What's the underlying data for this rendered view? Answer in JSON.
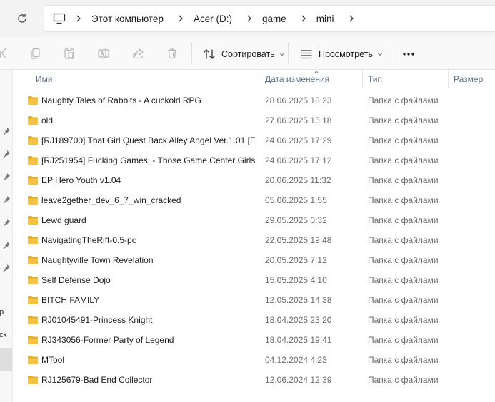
{
  "address": {
    "breadcrumbs": [
      "Этот компьютер",
      "Acer (D:)",
      "game",
      "mini"
    ]
  },
  "toolbar": {
    "sort_label": "Сортировать",
    "view_label": "Просмотреть",
    "more_label": "···"
  },
  "nav": {
    "text_1": "р",
    "text_2": "ск"
  },
  "columns": {
    "name": "Имя",
    "date": "Дата изменения",
    "type": "Тип",
    "size": "Размер"
  },
  "files": [
    {
      "name": "Naughty Tales of Rabbits - A cuckold RPG",
      "date": "28.06.2025 18:23",
      "type": "Папка с файлами"
    },
    {
      "name": "old",
      "date": "27.06.2025 15:18",
      "type": "Папка с файлами"
    },
    {
      "name": "[RJ189700] That Girl Quest Back Alley Angel Ver.1.01 [E...",
      "date": "24.06.2025 17:29",
      "type": "Папка с файлами"
    },
    {
      "name": "[RJ251954] Fucking Games! - Those Game Center Girls ...",
      "date": "24.06.2025 17:12",
      "type": "Папка с файлами"
    },
    {
      "name": "EP Hero Youth v1.04",
      "date": "20.06.2025 11:32",
      "type": "Папка с файлами"
    },
    {
      "name": "leave2gether_dev_6_7_win_cracked",
      "date": "05.06.2025 1:55",
      "type": "Папка с файлами"
    },
    {
      "name": "Lewd guard",
      "date": "29.05.2025 0:32",
      "type": "Папка с файлами"
    },
    {
      "name": "NavigatingTheRift-0.5-pc",
      "date": "22.05.2025 19:48",
      "type": "Папка с файлами"
    },
    {
      "name": "Naughtyville Town Revelation",
      "date": "20.05.2025 7:12",
      "type": "Папка с файлами"
    },
    {
      "name": "Self Defense Dojo",
      "date": "15.05.2025 4:10",
      "type": "Папка с файлами"
    },
    {
      "name": "BITCH FAMILY",
      "date": "12.05.2025 14:38",
      "type": "Папка с файлами"
    },
    {
      "name": "RJ01045491-Princess Knight",
      "date": "18.04.2025 23:20",
      "type": "Папка с файлами"
    },
    {
      "name": "RJ343056-Former Party of Legend",
      "date": "18.04.2025 19:41",
      "type": "Папка с файлами"
    },
    {
      "name": "MTool",
      "date": "04.12.2024 4:23",
      "type": "Папка с файлами"
    },
    {
      "name": "RJ125679-Bad End Collector",
      "date": "12.06.2024 12:39",
      "type": "Папка с файлами"
    }
  ],
  "colors": {
    "folder": "#f4c246",
    "folder_dark": "#e5a91f",
    "header_text": "#5a6d8a"
  }
}
